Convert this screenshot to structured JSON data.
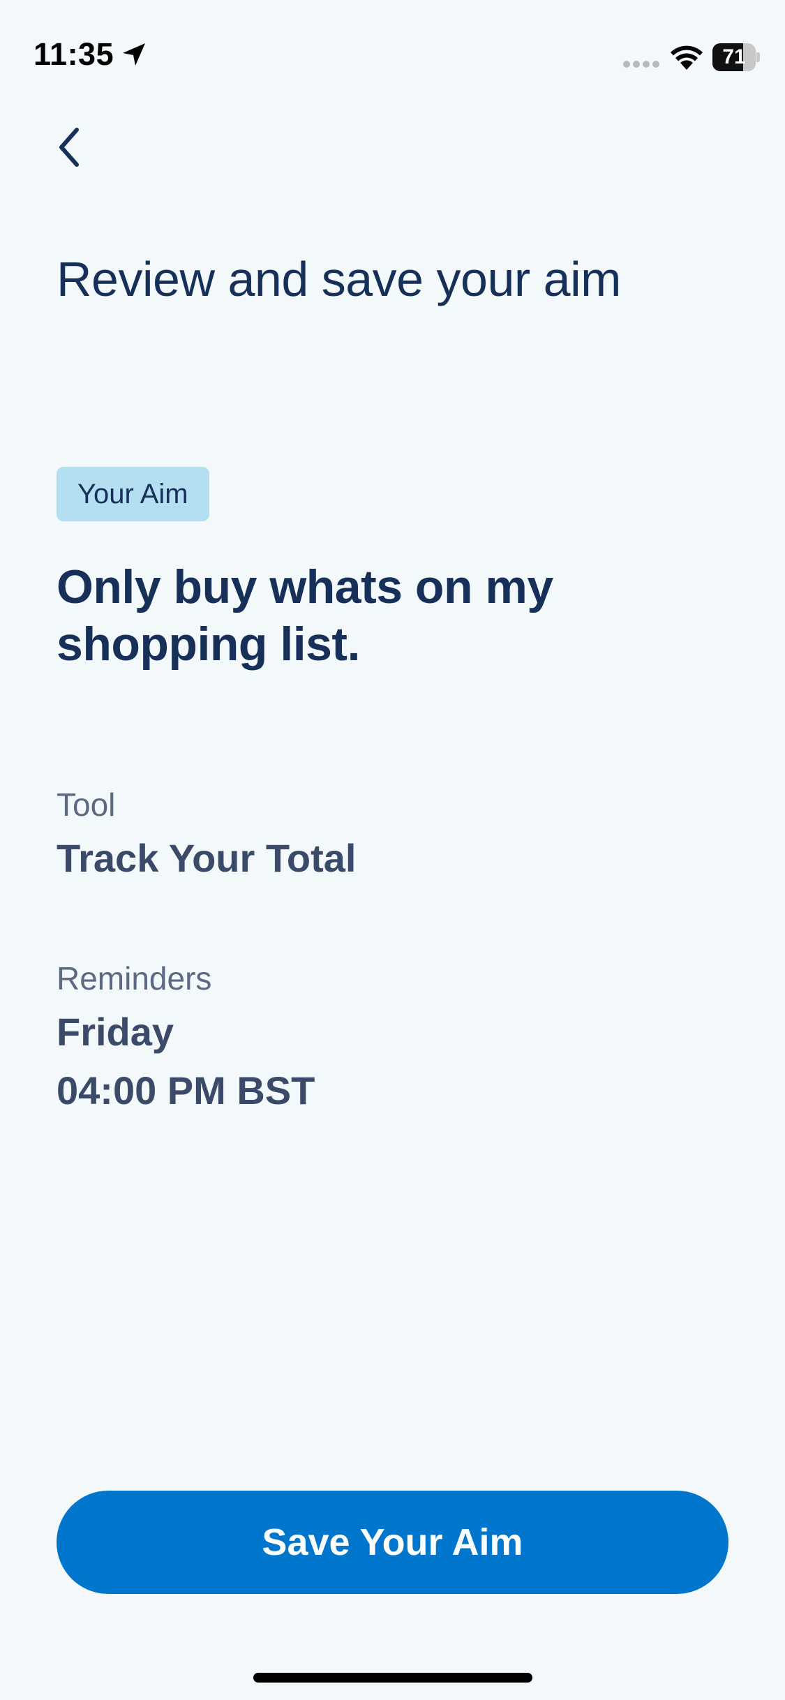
{
  "status_bar": {
    "time": "11:35",
    "battery_level": "71",
    "battery_fraction": 0.71,
    "icons": [
      "location-arrow-icon",
      "signal-icon",
      "wifi-icon",
      "battery-icon"
    ]
  },
  "nav": {
    "back_icon": "chevron-left-icon"
  },
  "page": {
    "title": "Review and save your aim"
  },
  "aim": {
    "badge_label": "Your Aim",
    "text": "Only buy whats on my shopping list."
  },
  "tool": {
    "label": "Tool",
    "value": "Track Your Total"
  },
  "reminders": {
    "label": "Reminders",
    "day": "Friday",
    "time": "04:00 PM BST"
  },
  "actions": {
    "save_label": "Save Your Aim"
  },
  "colors": {
    "background": "#f3f8fa",
    "primary": "#0075cc",
    "heading": "#17305a",
    "badge": "#b3dff0"
  }
}
